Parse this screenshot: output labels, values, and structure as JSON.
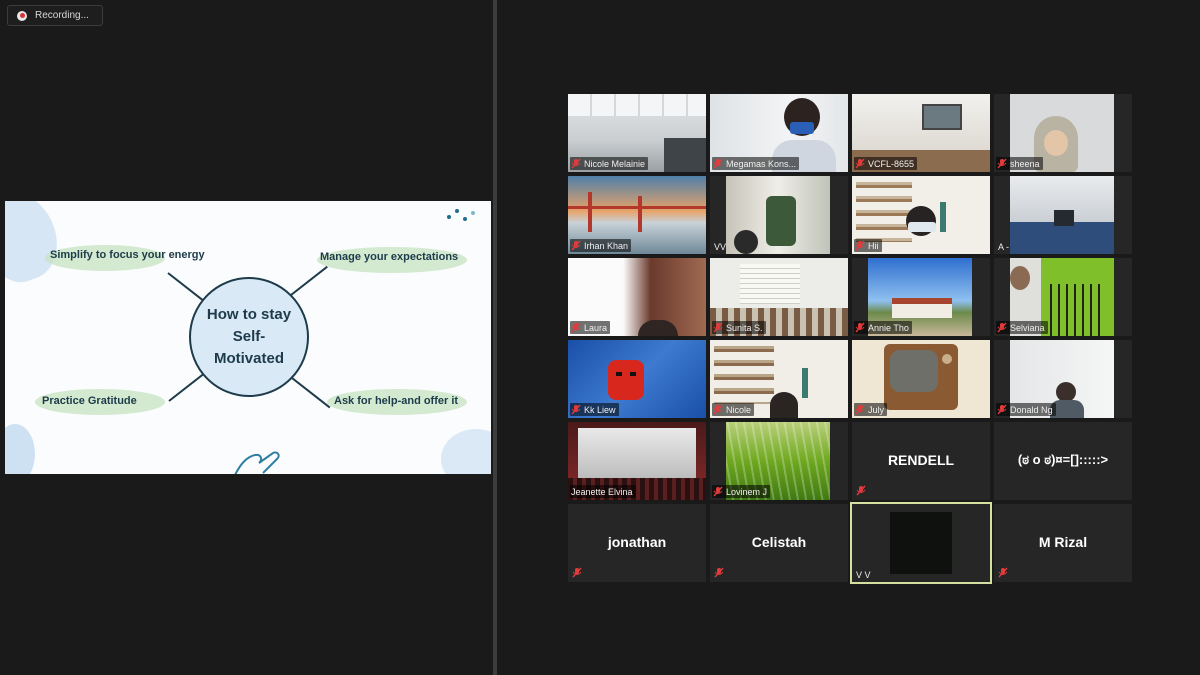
{
  "recording": {
    "label": "Recording..."
  },
  "slide": {
    "center": "How to stay Self-Motivated",
    "top_left": "Simplify to focus your energy",
    "top_right": "Manage your expectations",
    "bottom_left": "Practice Gratitude",
    "bottom_right": "Ask for help-and offer it"
  },
  "participants": [
    {
      "name": "Nicole Melainie"
    },
    {
      "name": "Megamas Kons..."
    },
    {
      "name": "VCFL-8655"
    },
    {
      "name": "sheena"
    },
    {
      "name": "Irhan Khan"
    },
    {
      "name": "VV"
    },
    {
      "name": "Hii"
    },
    {
      "name": "A -"
    },
    {
      "name": "Laura"
    },
    {
      "name": "Sunita S."
    },
    {
      "name": "Annie Tho"
    },
    {
      "name": "Selviana"
    },
    {
      "name": "Kk Liew"
    },
    {
      "name": "Nicole"
    },
    {
      "name": "July"
    },
    {
      "name": "Donald Ng"
    },
    {
      "name": "Jeanette Elvina"
    },
    {
      "name": "Lovinem J"
    },
    {
      "name": "RENDELL"
    },
    {
      "name": "(ಠ o ಠ)¤=[]:::::>"
    },
    {
      "name": "jonathan"
    },
    {
      "name": "Celistah"
    },
    {
      "name": "V V"
    },
    {
      "name": "M Rizal"
    }
  ]
}
